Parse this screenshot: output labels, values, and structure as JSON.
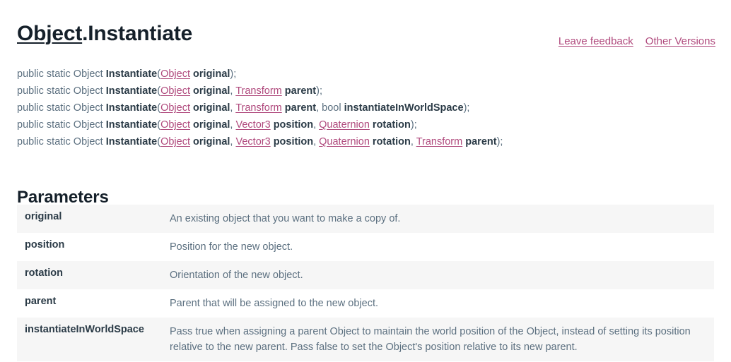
{
  "title": {
    "link_text": "Object",
    "rest_text": ".Instantiate"
  },
  "util_links": [
    {
      "label": "Leave feedback",
      "name": "leave-feedback-link"
    },
    {
      "label": "Other Versions",
      "name": "other-versions-link"
    }
  ],
  "signatures": [
    {
      "modifier": "public static Object ",
      "method": "Instantiate",
      "open": "(",
      "tokens": [
        {
          "kind": "type",
          "text": "Object"
        },
        {
          "kind": "space",
          "text": " "
        },
        {
          "kind": "param",
          "text": "original"
        }
      ],
      "close": ");"
    },
    {
      "modifier": "public static Object ",
      "method": "Instantiate",
      "open": "(",
      "tokens": [
        {
          "kind": "type",
          "text": "Object"
        },
        {
          "kind": "space",
          "text": " "
        },
        {
          "kind": "param",
          "text": "original"
        },
        {
          "kind": "punct",
          "text": ", "
        },
        {
          "kind": "type",
          "text": "Transform"
        },
        {
          "kind": "space",
          "text": " "
        },
        {
          "kind": "param",
          "text": "parent"
        }
      ],
      "close": ");"
    },
    {
      "modifier": "public static Object ",
      "method": "Instantiate",
      "open": "(",
      "tokens": [
        {
          "kind": "type",
          "text": "Object"
        },
        {
          "kind": "space",
          "text": " "
        },
        {
          "kind": "param",
          "text": "original"
        },
        {
          "kind": "punct",
          "text": ", "
        },
        {
          "kind": "type",
          "text": "Transform"
        },
        {
          "kind": "space",
          "text": " "
        },
        {
          "kind": "param",
          "text": "parent"
        },
        {
          "kind": "punct",
          "text": ", "
        },
        {
          "kind": "kw",
          "text": "bool"
        },
        {
          "kind": "space",
          "text": " "
        },
        {
          "kind": "param",
          "text": "instantiateInWorldSpace"
        }
      ],
      "close": ");"
    },
    {
      "modifier": "public static Object ",
      "method": "Instantiate",
      "open": "(",
      "tokens": [
        {
          "kind": "type",
          "text": "Object"
        },
        {
          "kind": "space",
          "text": " "
        },
        {
          "kind": "param",
          "text": "original"
        },
        {
          "kind": "punct",
          "text": ", "
        },
        {
          "kind": "type",
          "text": "Vector3"
        },
        {
          "kind": "space",
          "text": " "
        },
        {
          "kind": "param",
          "text": "position"
        },
        {
          "kind": "punct",
          "text": ", "
        },
        {
          "kind": "type",
          "text": "Quaternion"
        },
        {
          "kind": "space",
          "text": " "
        },
        {
          "kind": "param",
          "text": "rotation"
        }
      ],
      "close": ");"
    },
    {
      "modifier": "public static Object ",
      "method": "Instantiate",
      "open": "(",
      "tokens": [
        {
          "kind": "type",
          "text": "Object"
        },
        {
          "kind": "space",
          "text": " "
        },
        {
          "kind": "param",
          "text": "original"
        },
        {
          "kind": "punct",
          "text": ", "
        },
        {
          "kind": "type",
          "text": "Vector3"
        },
        {
          "kind": "space",
          "text": " "
        },
        {
          "kind": "param",
          "text": "position"
        },
        {
          "kind": "punct",
          "text": ", "
        },
        {
          "kind": "type",
          "text": "Quaternion"
        },
        {
          "kind": "space",
          "text": " "
        },
        {
          "kind": "param",
          "text": "rotation"
        },
        {
          "kind": "punct",
          "text": ", "
        },
        {
          "kind": "type",
          "text": "Transform"
        },
        {
          "kind": "space",
          "text": " "
        },
        {
          "kind": "param",
          "text": "parent"
        }
      ],
      "close": ");"
    }
  ],
  "parameters_section": {
    "heading": "Parameters",
    "rows": [
      {
        "name": "original",
        "description": "An existing object that you want to make a copy of."
      },
      {
        "name": "position",
        "description": "Position for the new object."
      },
      {
        "name": "rotation",
        "description": "Orientation of the new object."
      },
      {
        "name": "parent",
        "description": "Parent that will be assigned to the new object."
      },
      {
        "name": "instantiateInWorldSpace",
        "description": "Pass true when assigning a parent Object to maintain the world position of the Object, instead of setting its position relative to the new parent. Pass false to set the Object's position relative to its new parent."
      }
    ]
  },
  "colors": {
    "link": "#b04a7d",
    "body_text": "#5c7080",
    "heading": "#15202a",
    "bold_text": "#2b3b47",
    "row_shaded": "#f6f6f6",
    "page_background": "#ffffff"
  }
}
